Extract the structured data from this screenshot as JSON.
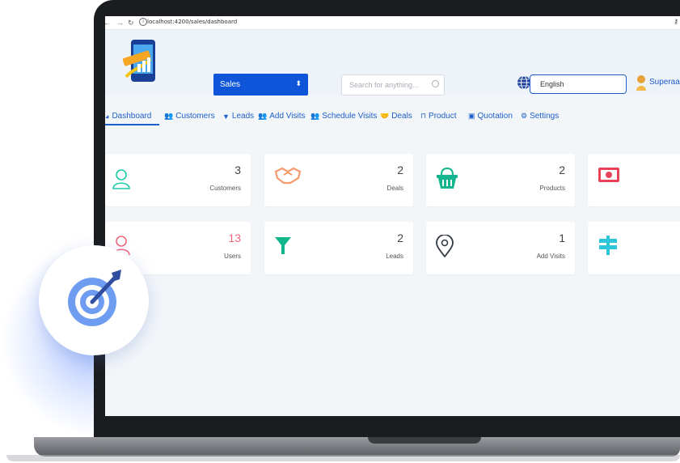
{
  "browser": {
    "url": "localhost:4200/sales/dashboard",
    "back_icon": "back-arrow-icon",
    "forward_icon": "forward-arrow-icon",
    "reload_icon": "reload-icon"
  },
  "header": {
    "module_select": "Sales",
    "search_placeholder": "Search for anything...",
    "language": "English",
    "user_name": "Superaa"
  },
  "nav": [
    {
      "label": "Dashboard",
      "icon": "dashboard-icon"
    },
    {
      "label": "Customers",
      "icon": "users-icon"
    },
    {
      "label": "Leads",
      "icon": "filter-icon"
    },
    {
      "label": "Add Visits",
      "icon": "users-icon"
    },
    {
      "label": "Schedule Visits",
      "icon": "users-icon"
    },
    {
      "label": "Deals",
      "icon": "handshake-icon"
    },
    {
      "label": "Product",
      "icon": "basket-icon"
    },
    {
      "label": "Quotation",
      "icon": "money-icon"
    },
    {
      "label": "Settings",
      "icon": "gears-icon"
    }
  ],
  "cards": [
    {
      "value": "3",
      "label": "Customers",
      "icon": "user-outline-icon",
      "color": "#1ccaa8"
    },
    {
      "value": "2",
      "label": "Deals",
      "icon": "handshake-icon",
      "color": "#f59b6c"
    },
    {
      "value": "2",
      "label": "Products",
      "icon": "basket-icon",
      "color": "#13b58e"
    },
    {
      "value": "",
      "label": "",
      "icon": "money-icon",
      "color": "#e84258"
    },
    {
      "value": "13",
      "label": "Users",
      "icon": "user-outline-icon",
      "color": "#f0677f"
    },
    {
      "value": "2",
      "label": "Leads",
      "icon": "filter-icon",
      "color": "#11b68c"
    },
    {
      "value": "1",
      "label": "Add Visits",
      "icon": "map-pin-icon",
      "color": "#333b45"
    },
    {
      "value": "",
      "label": "",
      "icon": "signpost-icon",
      "color": "#2ec5d9"
    }
  ],
  "colors": {
    "primary": "#1d5ec8",
    "select_bg": "#0e55d9",
    "users_value": "#f0677f"
  }
}
